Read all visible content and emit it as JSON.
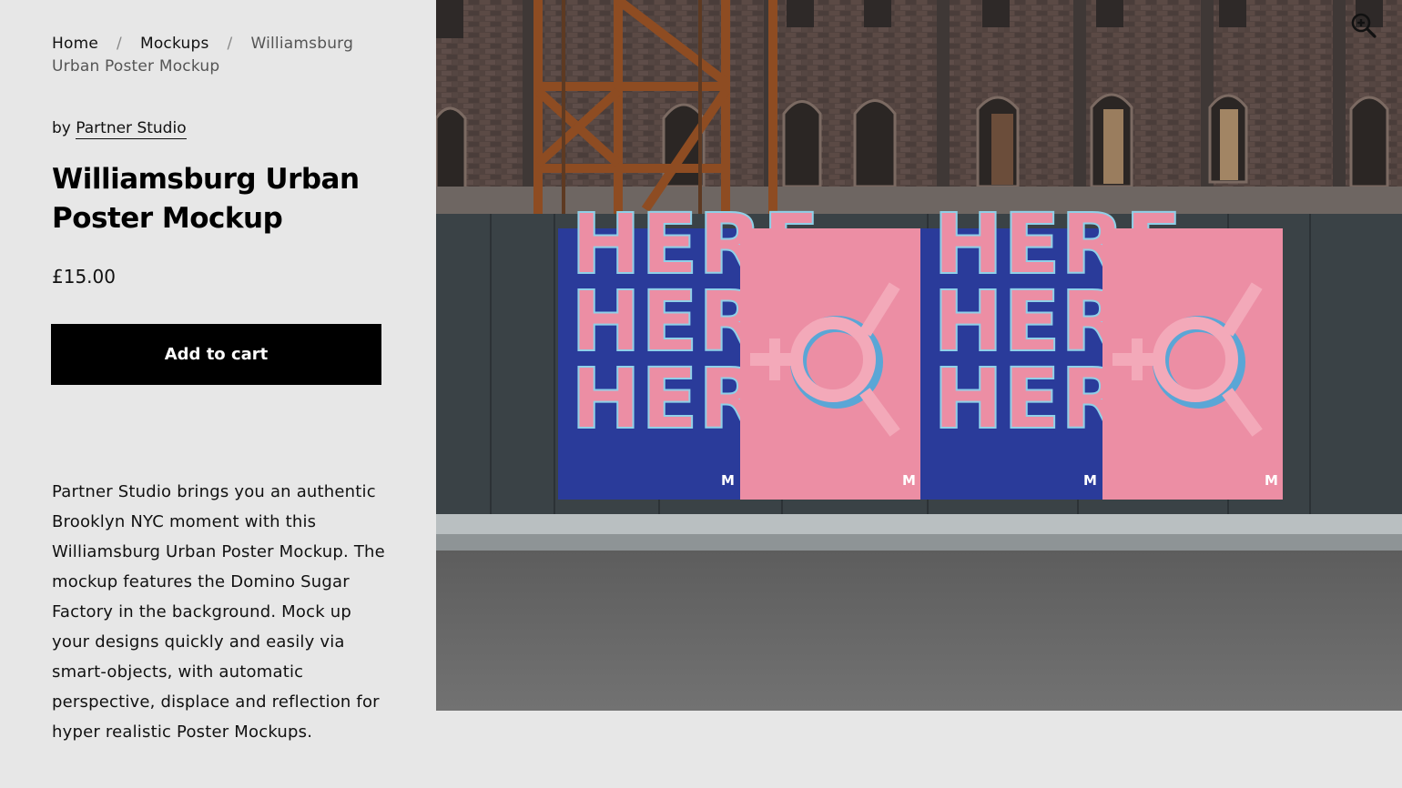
{
  "breadcrumb": {
    "home": "Home",
    "mockups": "Mockups",
    "separator": "/",
    "current": "Williamsburg Urban Poster Mockup"
  },
  "product": {
    "by_prefix": "by",
    "author": "Partner Studio",
    "title": "Williamsburg Urban Poster Mockup",
    "price": "£15.00",
    "add_to_cart": "Add to cart",
    "description": "Partner Studio brings you an authentic Brooklyn NYC moment with this Williamsburg Urban Poster Mockup. The mockup features the Domino Sugar Factory in the background. Mock up your designs quickly and easily via smart-objects, with automatic perspective, displace and reflection for hyper realistic Poster Mockups."
  },
  "hero": {
    "poster_word": "HERE",
    "zoom_icon": "zoom-in-icon",
    "colors": {
      "poster_blue": "#2a3b9a",
      "poster_pink": "#ec8ea4",
      "wall": "#3b4246",
      "brick": "#5c4a45",
      "steel": "#8a4a26",
      "road": "#6d6d6d"
    }
  }
}
